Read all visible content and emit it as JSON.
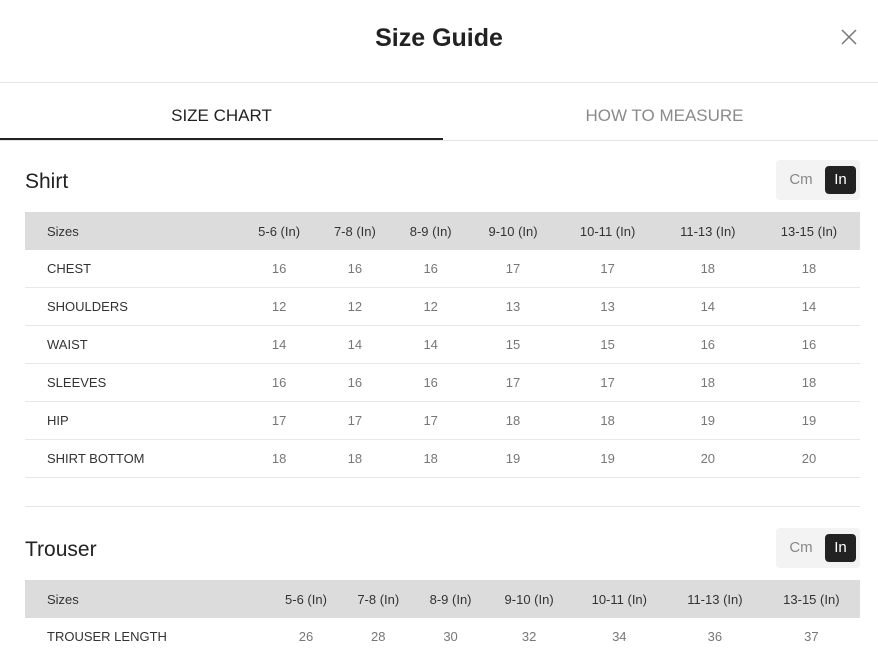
{
  "modal": {
    "title": "Size Guide",
    "close_icon": "close-icon"
  },
  "tabs": [
    {
      "label": "SIZE CHART",
      "active": true
    },
    {
      "label": "HOW TO MEASURE",
      "active": false
    }
  ],
  "shirt": {
    "title": "Shirt",
    "unit_cm": "Cm",
    "unit_in": "In",
    "headers": [
      "Sizes",
      "5-6 (In)",
      "7-8 (In)",
      "8-9 (In)",
      "9-10 (In)",
      "10-11 (In)",
      "11-13 (In)",
      "13-15 (In)"
    ],
    "rows": [
      [
        "CHEST",
        "16",
        "16",
        "16",
        "17",
        "17",
        "18",
        "18"
      ],
      [
        "SHOULDERS",
        "12",
        "12",
        "12",
        "13",
        "13",
        "14",
        "14"
      ],
      [
        "WAIST",
        "14",
        "14",
        "14",
        "15",
        "15",
        "16",
        "16"
      ],
      [
        "SLEEVES",
        "16",
        "16",
        "16",
        "17",
        "17",
        "18",
        "18"
      ],
      [
        "HIP",
        "17",
        "17",
        "17",
        "18",
        "18",
        "19",
        "19"
      ],
      [
        "SHIRT BOTTOM",
        "18",
        "18",
        "18",
        "19",
        "19",
        "20",
        "20"
      ]
    ]
  },
  "trouser": {
    "title": "Trouser",
    "unit_cm": "Cm",
    "unit_in": "In",
    "headers": [
      "Sizes",
      "5-6 (In)",
      "7-8 (In)",
      "8-9 (In)",
      "9-10 (In)",
      "10-11 (In)",
      "11-13 (In)",
      "13-15 (In)"
    ],
    "rows": [
      [
        "TROUSER LENGTH",
        "26",
        "28",
        "30",
        "32",
        "34",
        "36",
        "37"
      ]
    ]
  },
  "colors": {
    "active_toggle": "#222222",
    "header_bg": "#dcdcdc",
    "border": "#e6e6e6"
  }
}
